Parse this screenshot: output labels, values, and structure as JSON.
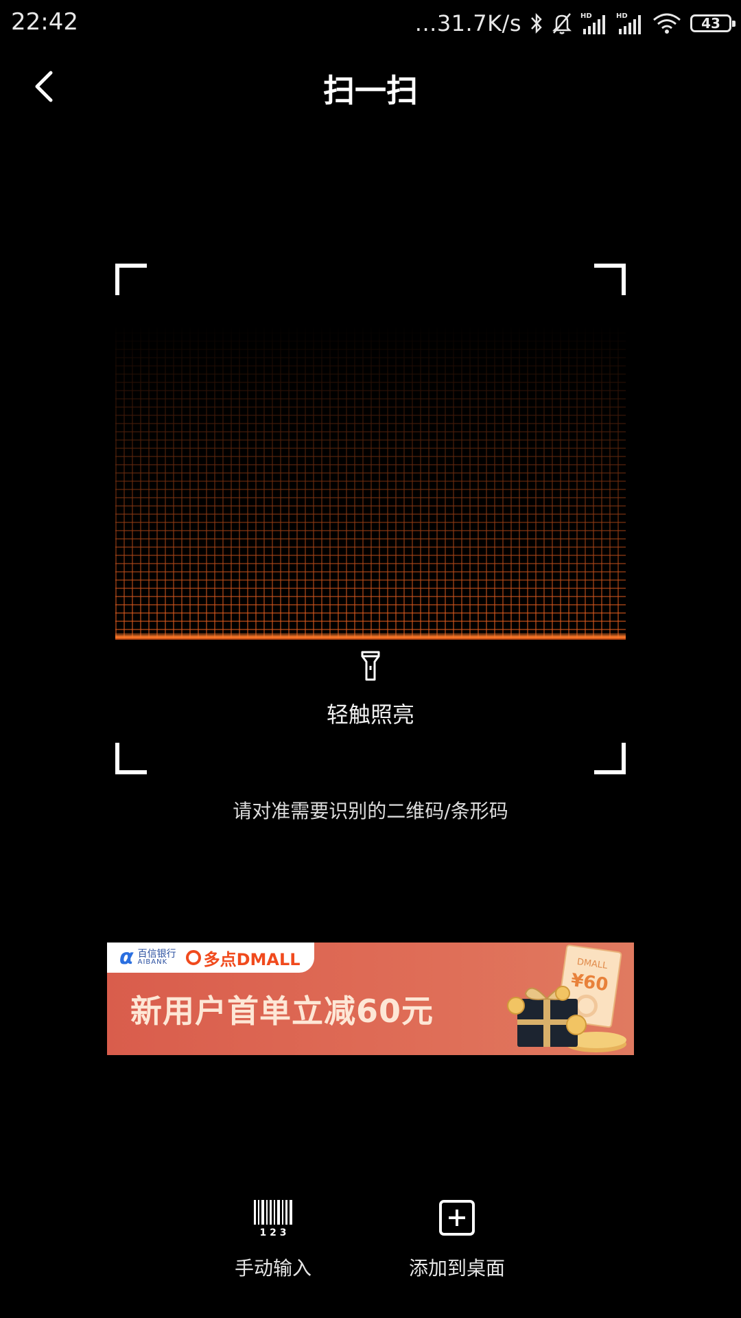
{
  "status_bar": {
    "time": "22:42",
    "net_speed": "...31.7K/s",
    "battery": "43",
    "icons": [
      "bluetooth-icon",
      "mute-bell-icon",
      "signal-hd-icon",
      "signal-hd-icon",
      "wifi-icon",
      "battery-icon"
    ]
  },
  "header": {
    "title": "扫一扫",
    "back_icon": "chevron-left-icon"
  },
  "scanner": {
    "flashlight_label": "轻触照亮",
    "hint": "请对准需要识别的二维码/条形码",
    "accent_color": "#ff7a2a"
  },
  "banner": {
    "bank_name": "百信银行",
    "bank_en": "AIBANK",
    "partner": "多点DMALL",
    "headline": "新用户首单立减60元",
    "coupon_brand": "DMALL",
    "coupon_value": "¥60"
  },
  "actions": [
    {
      "label": "手动输入",
      "icon": "barcode-icon",
      "icon_text": "1 2 3"
    },
    {
      "label": "添加到桌面",
      "icon": "add-square-icon"
    }
  ]
}
